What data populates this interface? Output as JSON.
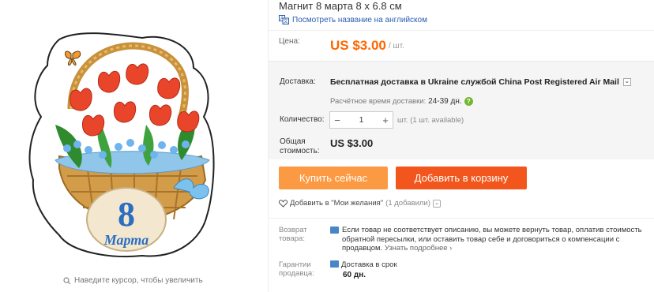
{
  "product": {
    "title": "Магнит 8 марта 8 x 6.8 см",
    "translate_link": "Посмотреть название на английском",
    "image_badge_number": "8",
    "image_badge_text": "Марта"
  },
  "price": {
    "label": "Цена:",
    "value": "US $3.00",
    "unit": "/ шт."
  },
  "shipping": {
    "label": "Доставка:",
    "text": "Бесплатная доставка в Ukraine службой China Post Registered Air Mail",
    "est_label": "Расчётное время доставки:",
    "est_value": "24-39 дн."
  },
  "quantity": {
    "label": "Количество:",
    "minus": "−",
    "value": "1",
    "plus": "+",
    "note": "шт. (1 шт. available)"
  },
  "total": {
    "label": "Общая стоимость:",
    "value": "US $3.00"
  },
  "buttons": {
    "buy_now": "Купить сейчас",
    "add_to_cart": "Добавить в корзину"
  },
  "wishlist": {
    "label": "Добавить в \"Мои желания\"",
    "count": "(1 добавили)"
  },
  "returns": {
    "label": "Возврат товара:",
    "text": "Если товар не соответствует описанию, вы можете вернуть товар, оплатив стоимость обратной пересылки, или оставить товар себе и договориться о компенсации с продавцом.",
    "more": "Узнать подробнее ›"
  },
  "guarantee": {
    "label": "Гарантии продавца:",
    "text": "Доставка в срок",
    "days": "60 дн."
  },
  "zoom_hint": "Наведите курсор, чтобы увеличить",
  "colors": {
    "price": "#ff6600",
    "buy_now": "#fc9a43",
    "add_to_cart": "#f2561c",
    "link": "#2a5db0"
  }
}
